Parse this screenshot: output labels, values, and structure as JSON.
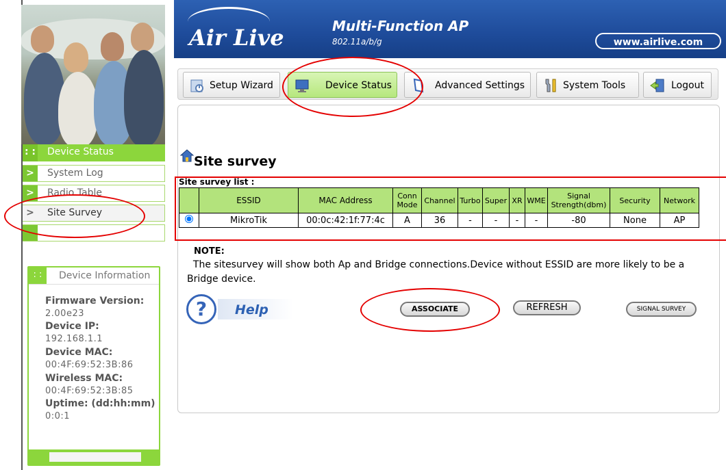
{
  "header": {
    "logo": "Air Live",
    "product_title": "Multi-Function AP",
    "product_subtitle": "802.11a/b/g",
    "url": "www.airlive.com"
  },
  "tabs": [
    {
      "label": "Setup Wizard",
      "icon": "wizard-icon"
    },
    {
      "label": "Device Status",
      "icon": "monitor-icon"
    },
    {
      "label": "Advanced Settings",
      "icon": "settings-icon"
    },
    {
      "label": "System Tools",
      "icon": "tools-icon"
    },
    {
      "label": "Logout",
      "icon": "logout-icon"
    }
  ],
  "sidebar": {
    "items": [
      {
        "label": "Device Status",
        "marker": ": :"
      },
      {
        "label": "System Log",
        "marker": ">"
      },
      {
        "label": "Radio Table",
        "marker": ">"
      },
      {
        "label": "Site Survey",
        "marker": ">"
      }
    ],
    "info": {
      "title": "Device Information",
      "fields": [
        {
          "label": "Firmware Version:",
          "value": "2.00e23"
        },
        {
          "label": "Device IP:",
          "value": "192.168.1.1"
        },
        {
          "label": "Device MAC:",
          "value": "00:4F:69:52:3B:86"
        },
        {
          "label": "Wireless MAC:",
          "value": "00:4F:69:52:3B:85"
        },
        {
          "label": "Uptime: (dd:hh:mm)",
          "value": "0:0:1"
        }
      ]
    }
  },
  "main": {
    "title": "Site survey",
    "list_label": "Site survey list :",
    "table": {
      "headers": [
        "",
        "ESSID",
        "MAC Address",
        "Conn Mode",
        "Channel",
        "Turbo",
        "Super",
        "XR",
        "WME",
        "Signal Strength(dbm)",
        "Security",
        "Network"
      ],
      "rows": [
        {
          "selected": true,
          "cells": [
            "MikroTik",
            "00:0c:42:1f:77:4c",
            "A",
            "36",
            "-",
            "-",
            "-",
            "-",
            "-80",
            "None",
            "AP"
          ]
        }
      ]
    },
    "note_label": "NOTE:",
    "note_text": "The sitesurvey will show both Ap and Bridge connections.Device without ESSID are more likely to be a Bridge device.",
    "help_label": "Help",
    "buttons": {
      "associate": "ASSOCIATE",
      "refresh": "REFRESH",
      "signal_survey": "SIGNAL SURVEY"
    }
  },
  "colors": {
    "brand_blue": "#1e4b9a",
    "accent_green": "#8cd63c",
    "annotation_red": "#e40000"
  }
}
